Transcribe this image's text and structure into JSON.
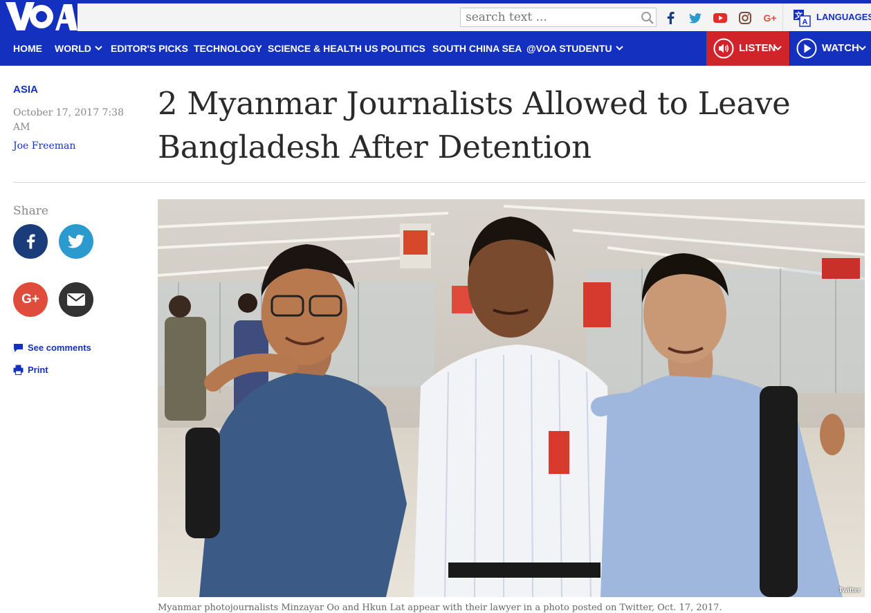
{
  "brand": {
    "logo_text": "VOA"
  },
  "header": {
    "search_placeholder": "search text ...",
    "social_icons": [
      "facebook-icon",
      "twitter-icon",
      "youtube-icon",
      "instagram-icon",
      "google-plus-icon"
    ],
    "gplus_label": "G+",
    "languages_label": "LANGUAGES"
  },
  "nav": {
    "items": [
      {
        "label": "HOME",
        "has_dropdown": false
      },
      {
        "label": "WORLD",
        "has_dropdown": true
      },
      {
        "label": "EDITOR'S PICKS",
        "has_dropdown": false
      },
      {
        "label": "TECHNOLOGY",
        "has_dropdown": false
      },
      {
        "label": "SCIENCE & HEALTH",
        "has_dropdown": false
      },
      {
        "label": "US POLITICS",
        "has_dropdown": false
      },
      {
        "label": "SOUTH CHINA SEA",
        "has_dropdown": false
      },
      {
        "label": "@VOA STUDENTU",
        "has_dropdown": true
      }
    ],
    "listen_label": "LISTEN",
    "watch_label": "WATCH"
  },
  "article": {
    "category": "ASIA",
    "date": "October 17, 2017 7:38 AM",
    "author": "Joe Freeman",
    "headline": "2 Myanmar Journalists Allowed to Leave Bangladesh After Detention"
  },
  "share": {
    "label": "Share",
    "buttons": [
      "facebook-icon",
      "twitter-icon",
      "google-plus-icon",
      "email-icon"
    ],
    "gplus_label": "G+",
    "see_comments": "See comments",
    "print": "Print"
  },
  "photo": {
    "credit": "Twitter",
    "caption": "Myanmar photojournalists Minzayar Oo and Hkun Lat appear with their lawyer in a photo posted on Twitter, Oct. 17, 2017."
  },
  "colors": {
    "brand_blue": "#1330bf",
    "listen_red": "#d1242a",
    "topbar_bg": "#f4f4f4"
  }
}
